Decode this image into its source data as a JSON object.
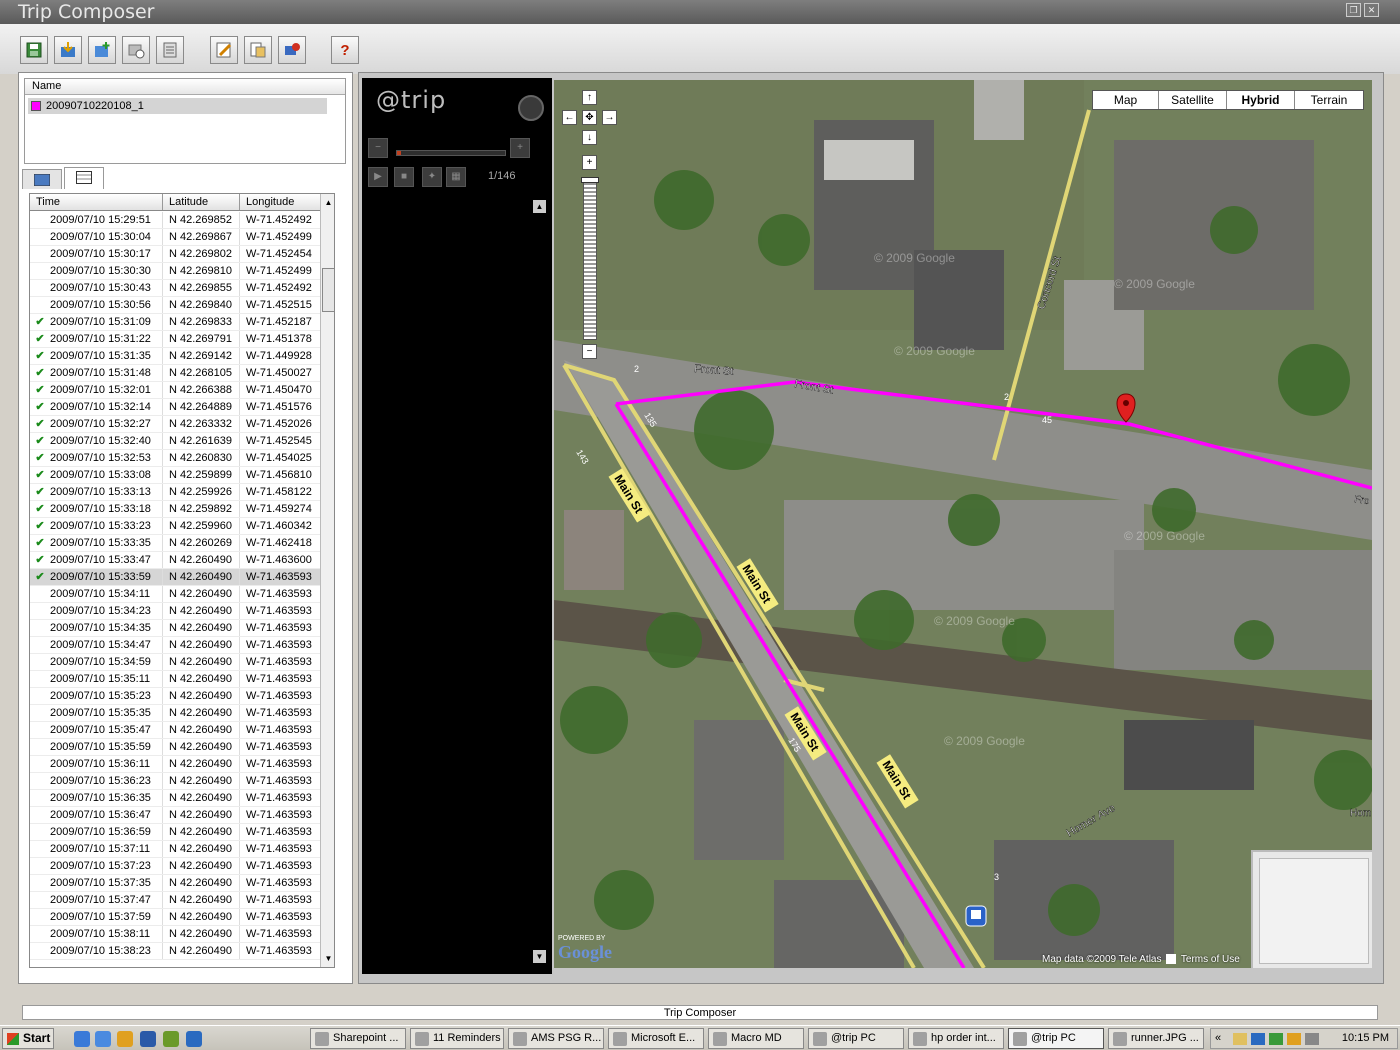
{
  "window": {
    "title": "Trip Composer"
  },
  "toolbar": {
    "buttons": [
      {
        "name": "save-icon"
      },
      {
        "name": "import-icon"
      },
      {
        "name": "add-photo-icon"
      },
      {
        "name": "time-sync-icon"
      },
      {
        "name": "export-icon"
      },
      {
        "name": "edit-icon"
      },
      {
        "name": "properties-icon"
      },
      {
        "name": "geotag-icon"
      },
      {
        "name": "help-icon",
        "label": "?"
      }
    ]
  },
  "tracks": {
    "header": "Name",
    "items": [
      {
        "label": "20090710220108_1",
        "color": "#ff00ff"
      }
    ]
  },
  "points": {
    "columns": [
      "Time",
      "Latitude",
      "Longitude"
    ],
    "rows": [
      {
        "check": "",
        "time": "2009/07/10 15:29:51",
        "lat": "N 42.269852",
        "lon": "W-71.452492"
      },
      {
        "check": "",
        "time": "2009/07/10 15:30:04",
        "lat": "N 42.269867",
        "lon": "W-71.452499"
      },
      {
        "check": "",
        "time": "2009/07/10 15:30:17",
        "lat": "N 42.269802",
        "lon": "W-71.452454"
      },
      {
        "check": "",
        "time": "2009/07/10 15:30:30",
        "lat": "N 42.269810",
        "lon": "W-71.452499"
      },
      {
        "check": "",
        "time": "2009/07/10 15:30:43",
        "lat": "N 42.269855",
        "lon": "W-71.452492"
      },
      {
        "check": "",
        "time": "2009/07/10 15:30:56",
        "lat": "N 42.269840",
        "lon": "W-71.452515"
      },
      {
        "check": "✔",
        "time": "2009/07/10 15:31:09",
        "lat": "N 42.269833",
        "lon": "W-71.452187"
      },
      {
        "check": "✔",
        "time": "2009/07/10 15:31:22",
        "lat": "N 42.269791",
        "lon": "W-71.451378"
      },
      {
        "check": "✔",
        "time": "2009/07/10 15:31:35",
        "lat": "N 42.269142",
        "lon": "W-71.449928"
      },
      {
        "check": "✔",
        "time": "2009/07/10 15:31:48",
        "lat": "N 42.268105",
        "lon": "W-71.450027"
      },
      {
        "check": "✔",
        "time": "2009/07/10 15:32:01",
        "lat": "N 42.266388",
        "lon": "W-71.450470"
      },
      {
        "check": "✔",
        "time": "2009/07/10 15:32:14",
        "lat": "N 42.264889",
        "lon": "W-71.451576"
      },
      {
        "check": "✔",
        "time": "2009/07/10 15:32:27",
        "lat": "N 42.263332",
        "lon": "W-71.452026"
      },
      {
        "check": "✔",
        "time": "2009/07/10 15:32:40",
        "lat": "N 42.261639",
        "lon": "W-71.452545"
      },
      {
        "check": "✔",
        "time": "2009/07/10 15:32:53",
        "lat": "N 42.260830",
        "lon": "W-71.454025"
      },
      {
        "check": "✔",
        "time": "2009/07/10 15:33:08",
        "lat": "N 42.259899",
        "lon": "W-71.456810"
      },
      {
        "check": "✔",
        "time": "2009/07/10 15:33:13",
        "lat": "N 42.259926",
        "lon": "W-71.458122"
      },
      {
        "check": "✔",
        "time": "2009/07/10 15:33:18",
        "lat": "N 42.259892",
        "lon": "W-71.459274"
      },
      {
        "check": "✔",
        "time": "2009/07/10 15:33:23",
        "lat": "N 42.259960",
        "lon": "W-71.460342"
      },
      {
        "check": "✔",
        "time": "2009/07/10 15:33:35",
        "lat": "N 42.260269",
        "lon": "W-71.462418"
      },
      {
        "check": "✔",
        "time": "2009/07/10 15:33:47",
        "lat": "N 42.260490",
        "lon": "W-71.463600"
      },
      {
        "check": "✔",
        "time": "2009/07/10 15:33:59",
        "lat": "N 42.260490",
        "lon": "W-71.463593",
        "selected": true
      },
      {
        "check": "",
        "time": "2009/07/10 15:34:11",
        "lat": "N 42.260490",
        "lon": "W-71.463593"
      },
      {
        "check": "",
        "time": "2009/07/10 15:34:23",
        "lat": "N 42.260490",
        "lon": "W-71.463593"
      },
      {
        "check": "",
        "time": "2009/07/10 15:34:35",
        "lat": "N 42.260490",
        "lon": "W-71.463593"
      },
      {
        "check": "",
        "time": "2009/07/10 15:34:47",
        "lat": "N 42.260490",
        "lon": "W-71.463593"
      },
      {
        "check": "",
        "time": "2009/07/10 15:34:59",
        "lat": "N 42.260490",
        "lon": "W-71.463593"
      },
      {
        "check": "",
        "time": "2009/07/10 15:35:11",
        "lat": "N 42.260490",
        "lon": "W-71.463593"
      },
      {
        "check": "",
        "time": "2009/07/10 15:35:23",
        "lat": "N 42.260490",
        "lon": "W-71.463593"
      },
      {
        "check": "",
        "time": "2009/07/10 15:35:35",
        "lat": "N 42.260490",
        "lon": "W-71.463593"
      },
      {
        "check": "",
        "time": "2009/07/10 15:35:47",
        "lat": "N 42.260490",
        "lon": "W-71.463593"
      },
      {
        "check": "",
        "time": "2009/07/10 15:35:59",
        "lat": "N 42.260490",
        "lon": "W-71.463593"
      },
      {
        "check": "",
        "time": "2009/07/10 15:36:11",
        "lat": "N 42.260490",
        "lon": "W-71.463593"
      },
      {
        "check": "",
        "time": "2009/07/10 15:36:23",
        "lat": "N 42.260490",
        "lon": "W-71.463593"
      },
      {
        "check": "",
        "time": "2009/07/10 15:36:35",
        "lat": "N 42.260490",
        "lon": "W-71.463593"
      },
      {
        "check": "",
        "time": "2009/07/10 15:36:47",
        "lat": "N 42.260490",
        "lon": "W-71.463593"
      },
      {
        "check": "",
        "time": "2009/07/10 15:36:59",
        "lat": "N 42.260490",
        "lon": "W-71.463593"
      },
      {
        "check": "",
        "time": "2009/07/10 15:37:11",
        "lat": "N 42.260490",
        "lon": "W-71.463593"
      },
      {
        "check": "",
        "time": "2009/07/10 15:37:23",
        "lat": "N 42.260490",
        "lon": "W-71.463593"
      },
      {
        "check": "",
        "time": "2009/07/10 15:37:35",
        "lat": "N 42.260490",
        "lon": "W-71.463593"
      },
      {
        "check": "",
        "time": "2009/07/10 15:37:47",
        "lat": "N 42.260490",
        "lon": "W-71.463593"
      },
      {
        "check": "",
        "time": "2009/07/10 15:37:59",
        "lat": "N 42.260490",
        "lon": "W-71.463593"
      },
      {
        "check": "",
        "time": "2009/07/10 15:38:11",
        "lat": "N 42.260490",
        "lon": "W-71.463593"
      },
      {
        "check": "",
        "time": "2009/07/10 15:38:23",
        "lat": "N 42.260490",
        "lon": "W-71.463593"
      }
    ]
  },
  "player": {
    "logo": "@trip",
    "counter": "1/146",
    "progress": 0.01
  },
  "map": {
    "types": [
      "Map",
      "Satellite",
      "Hybrid",
      "Terrain"
    ],
    "active_type": "Hybrid",
    "streets": [
      "Front St",
      "Front St",
      "Concord St",
      "Main St",
      "Main St",
      "Main St",
      "Main St",
      "Homer Ave",
      "Hom",
      "Fro"
    ],
    "route_numbers": [
      "135",
      "143",
      "175",
      "2",
      "2",
      "45",
      "2",
      "3"
    ],
    "watermark": "© 2009 Google",
    "copyright": "Map data ©2009 Tele Atlas",
    "terms": "Terms of Use",
    "google_label": "POWERED BY",
    "google_logo": "Google",
    "route_color": "#ff00ff"
  },
  "status": {
    "text": "Trip Composer"
  },
  "taskbar": {
    "start": "Start",
    "tasks": [
      "Sharepoint ...",
      "11 Reminders",
      "AMS PSG R...",
      "Microsoft E...",
      "Macro MD",
      "@trip PC",
      "hp order int...",
      "@trip PC",
      "runner.JPG ..."
    ],
    "active_index": 7,
    "clock": "10:15 PM"
  }
}
